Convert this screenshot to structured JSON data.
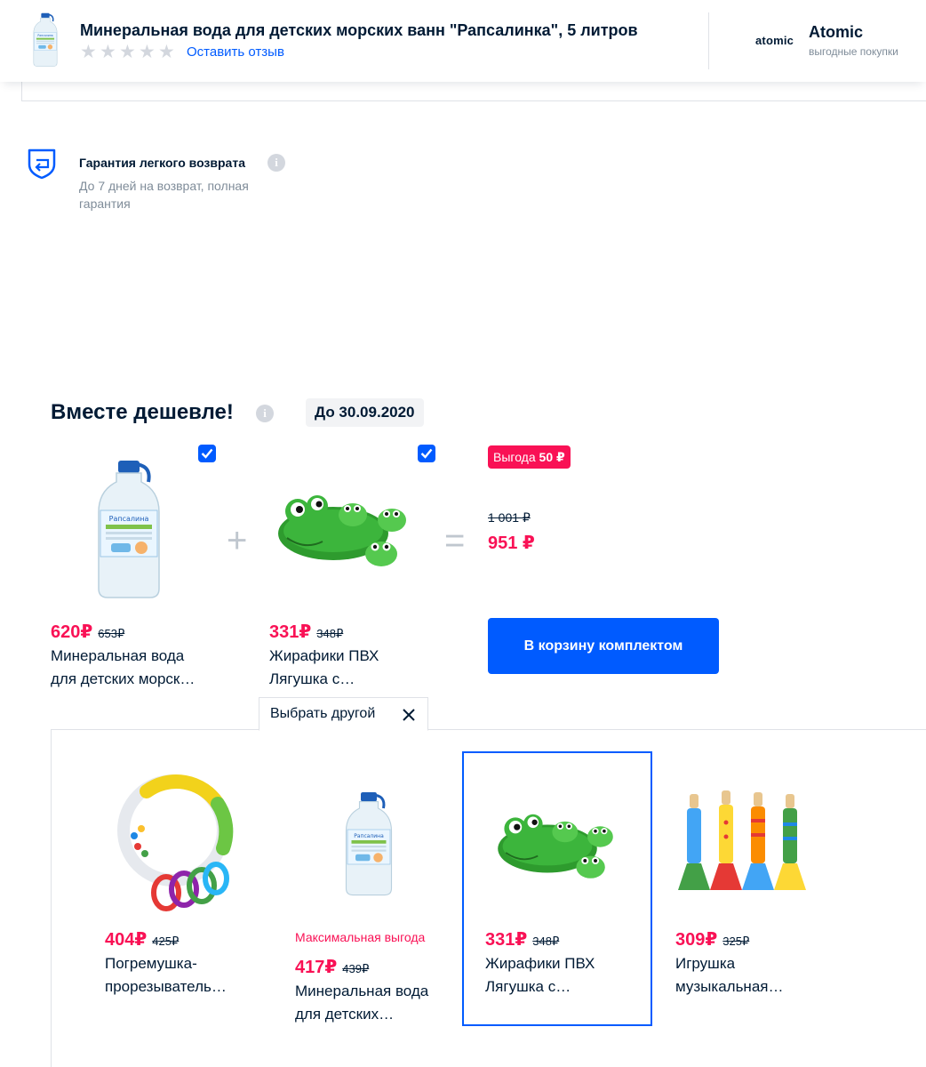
{
  "header": {
    "product_title": "Минеральная вода для детских морских ванн \"Рапсалинка\", 5 литров",
    "rating_stars": 0,
    "review_link": "Оставить отзыв",
    "seller_logo_text": "atomic",
    "seller_name": "Atomic",
    "seller_tagline": "выгодные покупки"
  },
  "guarantee": {
    "title": "Гарантия легкого возврата",
    "text": "До 7 дней на возврат, полная гарантия",
    "info_glyph": "i"
  },
  "bundle": {
    "title": "Вместе дешевле!",
    "info_glyph": "i",
    "valid_until": "До 30.09.2020",
    "saving_prefix": "Выгода",
    "saving_value": "50 ₽",
    "old_total": "1 001 ₽",
    "new_total": "951 ₽",
    "plus": "+",
    "equals": "=",
    "items": [
      {
        "price": "620₽",
        "old_price": "653₽",
        "name": "Минеральная вода для детских морск…",
        "checked": true,
        "icon": "water-bottle-icon"
      },
      {
        "price": "331₽",
        "old_price": "348₽",
        "name": "Жирафики ПВХ Лягушка с…",
        "checked": true,
        "icon": "frog-toy-icon"
      }
    ],
    "cart_button": "В корзину комплектом",
    "choose_other": "Выбрать другой"
  },
  "alternatives": {
    "max_gain_label": "Максимальная выгода",
    "selected_index": 2,
    "items": [
      {
        "price": "404₽",
        "old_price": "425₽",
        "name": "Погремушка-прорезыватель…",
        "icon": "rattle-teether-icon"
      },
      {
        "price": "417₽",
        "old_price": "439₽",
        "name": "Минеральная вода для детских…",
        "icon": "water-bottle-icon"
      },
      {
        "price": "331₽",
        "old_price": "348₽",
        "name": "Жирафики ПВХ Лягушка с…",
        "icon": "frog-toy-icon"
      },
      {
        "price": "309₽",
        "old_price": "325₽",
        "name": "Игрушка музыкальная…",
        "icon": "toy-trumpets-icon"
      }
    ]
  },
  "colors": {
    "accent": "#005bff",
    "sale": "#f91155",
    "text": "#001a34",
    "muted": "#7f8c99"
  }
}
